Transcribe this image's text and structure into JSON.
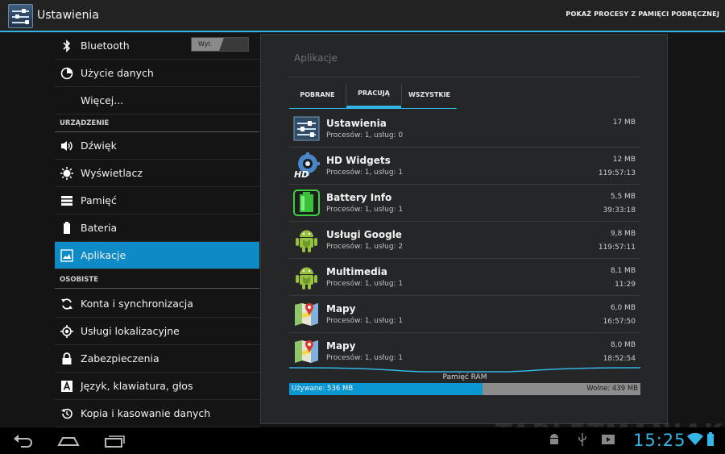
{
  "actionbar": {
    "title": "Ustawienia",
    "action": "POKAŻ PROCESY Z PAMIĘCI PODRĘCZNEJ"
  },
  "sidebar": {
    "bluetooth": {
      "label": "Bluetooth",
      "toggle": "Wył.",
      "icon": "bluetooth-icon"
    },
    "data_usage": {
      "label": "Użycie danych",
      "icon": "data-usage-icon"
    },
    "more": {
      "label": "Więcej..."
    },
    "header_device": "URZĄDZENIE",
    "sound": {
      "label": "Dźwięk",
      "icon": "speaker-icon"
    },
    "display": {
      "label": "Wyświetlacz",
      "icon": "brightness-icon"
    },
    "storage": {
      "label": "Pamięć",
      "icon": "storage-icon"
    },
    "battery": {
      "label": "Bateria",
      "icon": "battery-icon"
    },
    "apps": {
      "label": "Aplikacje",
      "icon": "apps-icon"
    },
    "header_personal": "OSOBISTE",
    "accounts": {
      "label": "Konta i synchronizacja",
      "icon": "sync-icon"
    },
    "location": {
      "label": "Usługi lokalizacyjne",
      "icon": "location-icon"
    },
    "security": {
      "label": "Zabezpieczenia",
      "icon": "lock-icon"
    },
    "language": {
      "label": "Język, klawiatura, głos",
      "icon": "keyboard-letter-icon"
    },
    "backup": {
      "label": "Kopia i kasowanie danych",
      "icon": "backup-icon"
    }
  },
  "detail": {
    "title": "Aplikacje",
    "tabs": [
      "POBRANE",
      "PRACUJĄ",
      "WSZYSTKIE"
    ],
    "apps": [
      {
        "name": "Ustawienia",
        "info": "Procesów: 1, usług: 0",
        "size": "17 MB",
        "time": "",
        "icon": "settings-app-icon"
      },
      {
        "name": "HD Widgets",
        "info": "Procesów: 1, usług: 1",
        "size": "12 MB",
        "time": "119:57:13",
        "icon": "hd-widgets-icon"
      },
      {
        "name": "Battery Info",
        "info": "Procesów: 1, usług: 1",
        "size": "5,5 MB",
        "time": "39:33:18",
        "icon": "battery-info-icon"
      },
      {
        "name": "Usługi Google",
        "info": "Procesów: 1, usług: 2",
        "size": "9,8 MB",
        "time": "119:57:11",
        "icon": "android-icon"
      },
      {
        "name": "Multimedia",
        "info": "Procesów: 1, usług: 1",
        "size": "8,1 MB",
        "time": "11:29",
        "icon": "android-icon"
      },
      {
        "name": "Mapy",
        "info": "Procesów: 1, usług: 1",
        "size": "6,0 MB",
        "time": "16:57:50",
        "icon": "maps-icon"
      },
      {
        "name": "Mapy",
        "info": "Procesów: 1, usług: 1",
        "size": "8,0 MB",
        "time": "18:52:54",
        "icon": "maps-icon"
      }
    ],
    "ram": {
      "title": "Pamięć RAM",
      "used": "Używane: 536 MB",
      "free": "Wolne: 439 MB",
      "used_fraction": 0.55
    }
  },
  "statusbar": {
    "clock": "15:25"
  },
  "watermark": "TABLETMANIAK",
  "colors": {
    "accent": "#33b5e5",
    "selected": "#0e8bc6"
  }
}
